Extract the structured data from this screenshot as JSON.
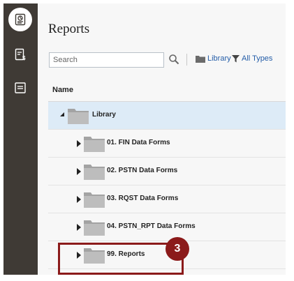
{
  "rail": {
    "items": [
      {
        "icon": "reports-icon",
        "active": true
      },
      {
        "icon": "financial-report-icon",
        "active": false
      },
      {
        "icon": "document-icon",
        "active": false
      }
    ]
  },
  "main": {
    "title": "Reports",
    "search": {
      "placeholder": "Search",
      "value": ""
    },
    "toolbar": {
      "library_label": "Library",
      "types_label": "All Types"
    },
    "table": {
      "name_header": "Name",
      "rows": [
        {
          "label": "Library",
          "level": 0,
          "expanded": true,
          "selected": true
        },
        {
          "label": "01. FIN Data Forms",
          "level": 1,
          "expanded": false,
          "selected": false
        },
        {
          "label": "02. PSTN Data Forms",
          "level": 1,
          "expanded": false,
          "selected": false
        },
        {
          "label": "03. RQST Data Forms",
          "level": 1,
          "expanded": false,
          "selected": false
        },
        {
          "label": "04. PSTN_RPT Data Forms",
          "level": 1,
          "expanded": false,
          "selected": false
        },
        {
          "label": "99. Reports",
          "level": 1,
          "expanded": false,
          "selected": false
        }
      ]
    }
  },
  "callout": {
    "number": "3",
    "color": "#8b1a1a"
  },
  "colors": {
    "rail": "#3f3a35",
    "selected_row": "#ddebf7",
    "link": "#245da8"
  }
}
